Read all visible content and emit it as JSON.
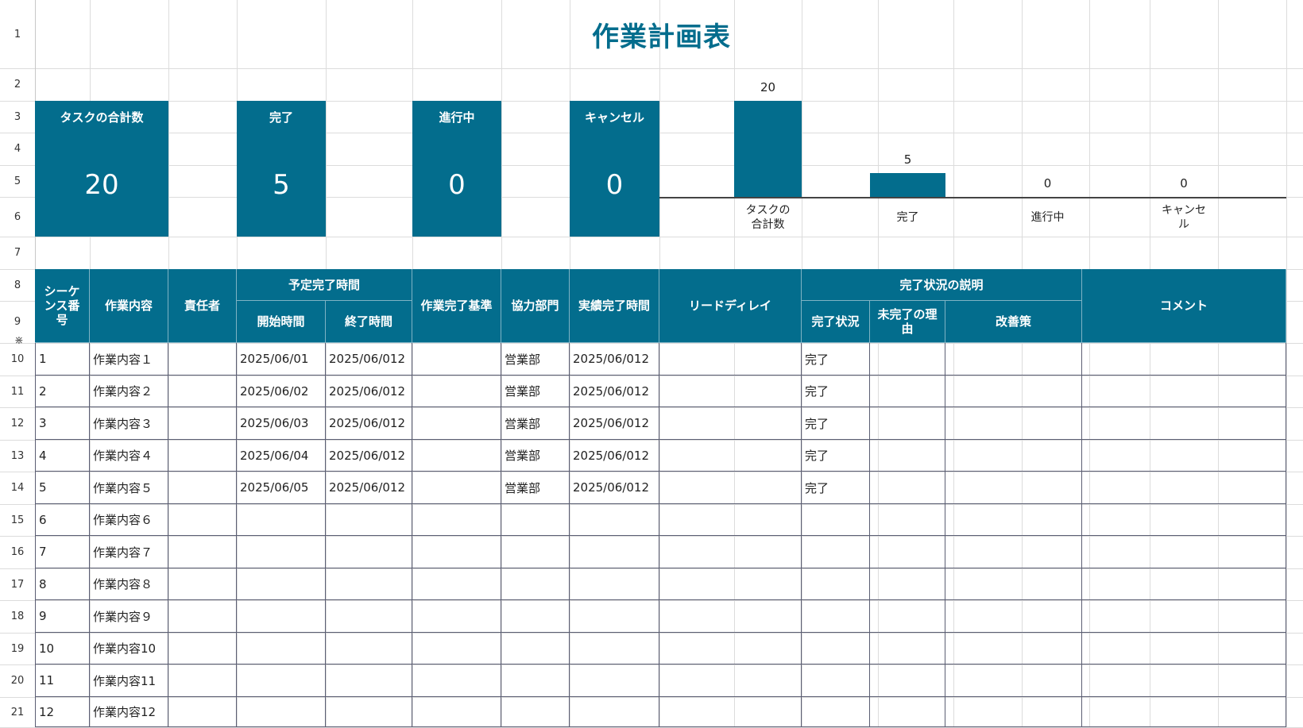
{
  "sheet": {
    "title": "作業計画表",
    "row_numbers": [
      "1",
      "2",
      "3",
      "4",
      "5",
      "6",
      "7",
      "8",
      "9",
      "10",
      "11",
      "12",
      "13",
      "14",
      "15",
      "16",
      "17",
      "18",
      "19",
      "20",
      "21"
    ]
  },
  "summary": {
    "cards": [
      {
        "label": "タスクの合計数",
        "value": "20"
      },
      {
        "label": "完了",
        "value": "5"
      },
      {
        "label": "進行中",
        "value": "0"
      },
      {
        "label": "キャンセル",
        "value": "0"
      }
    ]
  },
  "chart_data": {
    "type": "bar",
    "categories": [
      "タスクの合計数",
      "完了",
      "進行中",
      "キャンセル"
    ],
    "values": [
      20,
      5,
      0,
      0
    ],
    "data_labels": [
      "20",
      "5",
      "0",
      "0"
    ],
    "category_labels_wrapped": [
      [
        "タスクの",
        "合計数"
      ],
      [
        "完了"
      ],
      [
        "進行中"
      ],
      [
        "キャンセ",
        "ル"
      ]
    ],
    "color": "#036d8d",
    "ylim": [
      0,
      20
    ]
  },
  "table": {
    "headers": {
      "seq": "シーケンス番号",
      "seq_lines": [
        "シーケ",
        "ンス番",
        "号"
      ],
      "content": "作業内容",
      "owner": "責任者",
      "planned": "予定完了時間",
      "start": "開始時間",
      "end": "終了時間",
      "criteria": "作業完了基準",
      "dept": "協力部門",
      "actual": "実績完了時間",
      "lead": "リードディレイ",
      "status_group": "完了状況の説明",
      "status": "完了状況",
      "reason_lines": [
        "未完了の理",
        "由"
      ],
      "improve": "改善策",
      "comment": "コメント"
    },
    "rows": [
      {
        "seq": "1",
        "content": "作業内容１",
        "start": "2025/06/01",
        "end": "2025/06/012",
        "dept": "営業部",
        "actual": "2025/06/012",
        "status": "完了"
      },
      {
        "seq": "2",
        "content": "作業内容２",
        "start": "2025/06/02",
        "end": "2025/06/012",
        "dept": "営業部",
        "actual": "2025/06/012",
        "status": "完了"
      },
      {
        "seq": "3",
        "content": "作業内容３",
        "start": "2025/06/03",
        "end": "2025/06/012",
        "dept": "営業部",
        "actual": "2025/06/012",
        "status": "完了"
      },
      {
        "seq": "4",
        "content": "作業内容４",
        "start": "2025/06/04",
        "end": "2025/06/012",
        "dept": "営業部",
        "actual": "2025/06/012",
        "status": "完了"
      },
      {
        "seq": "5",
        "content": "作業内容５",
        "start": "2025/06/05",
        "end": "2025/06/012",
        "dept": "営業部",
        "actual": "2025/06/012",
        "status": "完了"
      },
      {
        "seq": "6",
        "content": "作業内容６",
        "start": "",
        "end": "",
        "dept": "",
        "actual": "",
        "status": ""
      },
      {
        "seq": "7",
        "content": "作業内容７",
        "start": "",
        "end": "",
        "dept": "",
        "actual": "",
        "status": ""
      },
      {
        "seq": "8",
        "content": "作業内容８",
        "start": "",
        "end": "",
        "dept": "",
        "actual": "",
        "status": ""
      },
      {
        "seq": "9",
        "content": "作業内容９",
        "start": "",
        "end": "",
        "dept": "",
        "actual": "",
        "status": ""
      },
      {
        "seq": "10",
        "content": "作業内容10",
        "start": "",
        "end": "",
        "dept": "",
        "actual": "",
        "status": ""
      },
      {
        "seq": "11",
        "content": "作業内容11",
        "start": "",
        "end": "",
        "dept": "",
        "actual": "",
        "status": ""
      },
      {
        "seq": "12",
        "content": "作業内容12",
        "start": "",
        "end": "",
        "dept": "",
        "actual": "",
        "status": ""
      }
    ]
  }
}
